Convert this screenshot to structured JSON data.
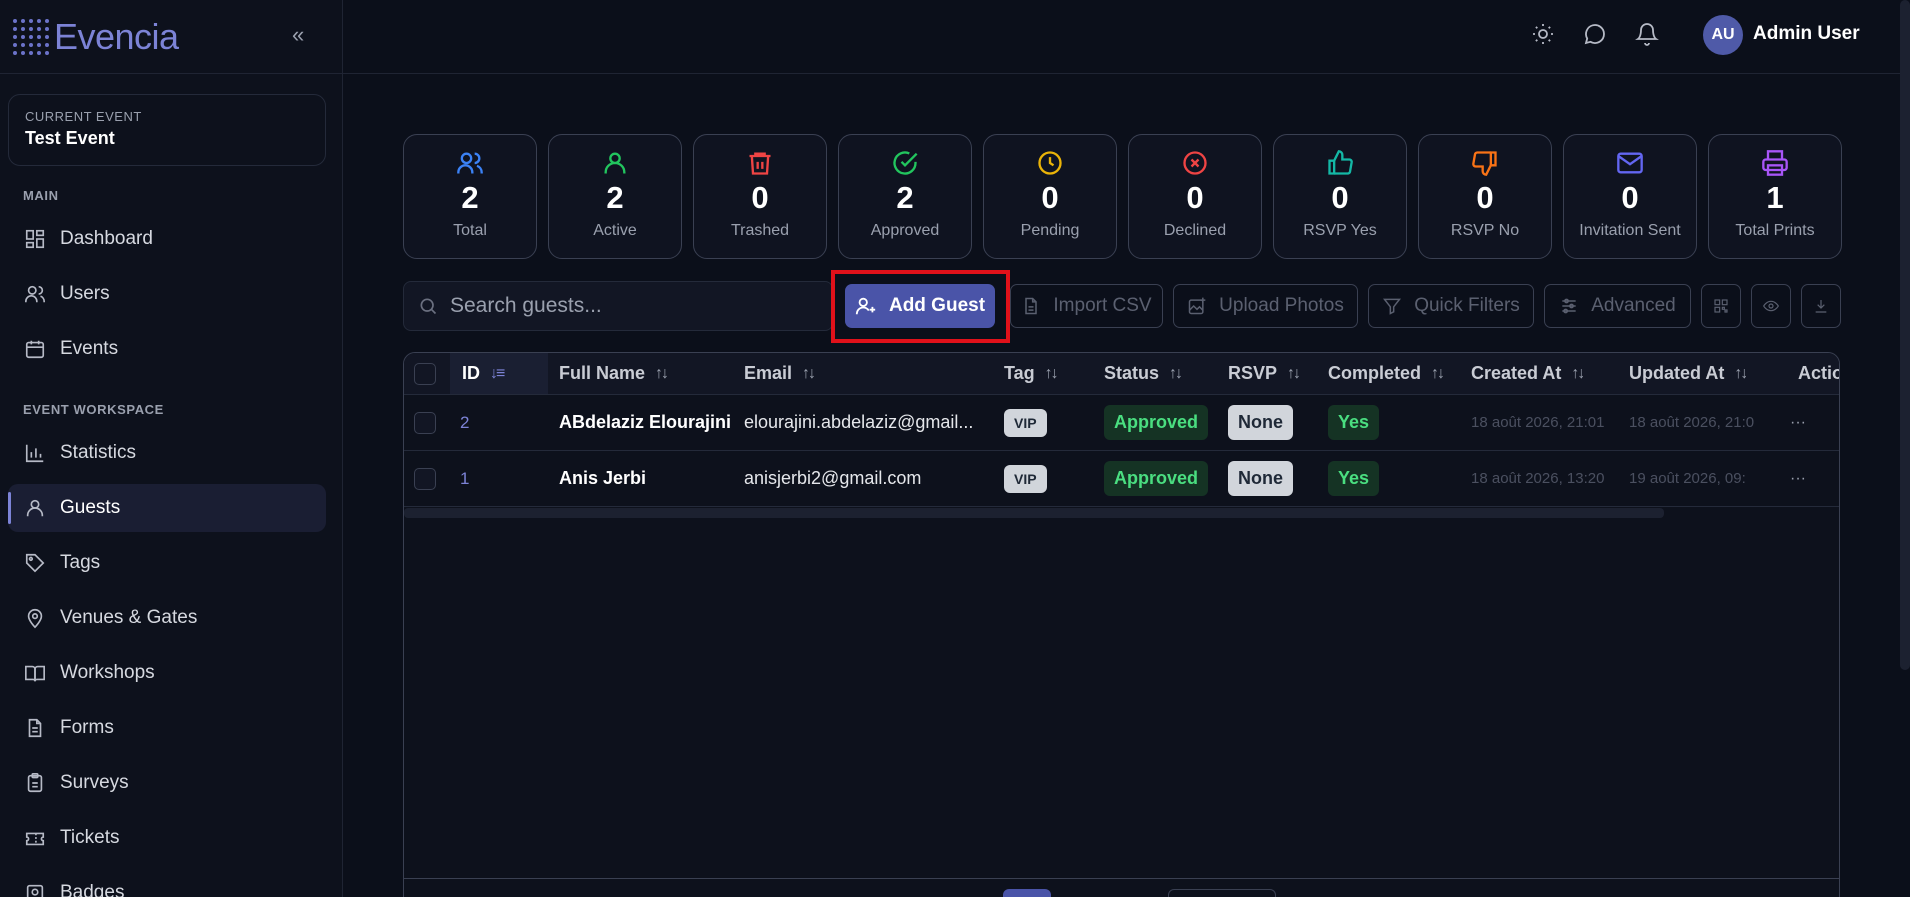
{
  "brand": {
    "name": "Evencia",
    "collapse_icon": "double-chevron-left-icon"
  },
  "current_event": {
    "label": "CURRENT EVENT",
    "name": "Test Event"
  },
  "sidebar": {
    "main_label": "MAIN",
    "main_items": [
      {
        "label": "Dashboard",
        "icon": "dashboard-icon"
      },
      {
        "label": "Users",
        "icon": "users-icon"
      },
      {
        "label": "Events",
        "icon": "calendar-icon"
      }
    ],
    "workspace_label": "EVENT WORKSPACE",
    "workspace_items": [
      {
        "label": "Statistics",
        "icon": "bar-chart-icon"
      },
      {
        "label": "Guests",
        "icon": "user-icon",
        "active": true
      },
      {
        "label": "Tags",
        "icon": "tag-icon"
      },
      {
        "label": "Venues & Gates",
        "icon": "map-pin-icon"
      },
      {
        "label": "Workshops",
        "icon": "book-open-icon"
      },
      {
        "label": "Forms",
        "icon": "file-text-icon"
      },
      {
        "label": "Surveys",
        "icon": "clipboard-icon"
      },
      {
        "label": "Tickets",
        "icon": "ticket-icon"
      },
      {
        "label": "Badges",
        "icon": "badge-icon"
      }
    ]
  },
  "header": {
    "avatar_initials": "AU",
    "user_name": "Admin User",
    "icons": [
      "sun-icon",
      "chat-icon",
      "bell-icon"
    ]
  },
  "stats": [
    {
      "value": "2",
      "label": "Total",
      "icon": "users-icon",
      "color": "#3b82f6"
    },
    {
      "value": "2",
      "label": "Active",
      "icon": "user-icon",
      "color": "#22c55e"
    },
    {
      "value": "0",
      "label": "Trashed",
      "icon": "trash-icon",
      "color": "#ef4444"
    },
    {
      "value": "2",
      "label": "Approved",
      "icon": "check-circle-icon",
      "color": "#22c55e"
    },
    {
      "value": "0",
      "label": "Pending",
      "icon": "clock-icon",
      "color": "#eab308"
    },
    {
      "value": "0",
      "label": "Declined",
      "icon": "x-circle-icon",
      "color": "#ef4444"
    },
    {
      "value": "0",
      "label": "RSVP Yes",
      "icon": "thumbs-up-icon",
      "color": "#14b8a6"
    },
    {
      "value": "0",
      "label": "RSVP No",
      "icon": "thumbs-down-icon",
      "color": "#f97316"
    },
    {
      "value": "0",
      "label": "Invitation Sent",
      "icon": "mail-icon",
      "color": "#6366f1"
    },
    {
      "value": "1",
      "label": "Total Prints",
      "icon": "printer-icon",
      "color": "#a855f7"
    }
  ],
  "toolbar": {
    "search_placeholder": "Search guests...",
    "add_guest": "Add Guest",
    "import_csv": "Import CSV",
    "upload_photos": "Upload Photos",
    "quick_filters": "Quick Filters",
    "advanced": "Advanced"
  },
  "table": {
    "headers": [
      "ID",
      "Full Name",
      "Email",
      "Tag",
      "Status",
      "RSVP",
      "Completed",
      "Created At",
      "Updated At",
      "Actions"
    ],
    "rows": [
      {
        "id": "2",
        "name": "ABdelaziz Elourajini",
        "email": "elourajini.abdelaziz@gmail...",
        "tag": "VIP",
        "status": "Approved",
        "rsvp": "None",
        "completed": "Yes",
        "created": "18 août 2026, 21:01",
        "updated": "18 août 2026, 21:0",
        "actions": "···"
      },
      {
        "id": "1",
        "name": "Anis Jerbi",
        "email": "anisjerbi2@gmail.com",
        "tag": "VIP",
        "status": "Approved",
        "rsvp": "None",
        "completed": "Yes",
        "created": "18 août 2026, 13:20",
        "updated": "19 août 2026, 09:",
        "actions": "···"
      }
    ]
  }
}
